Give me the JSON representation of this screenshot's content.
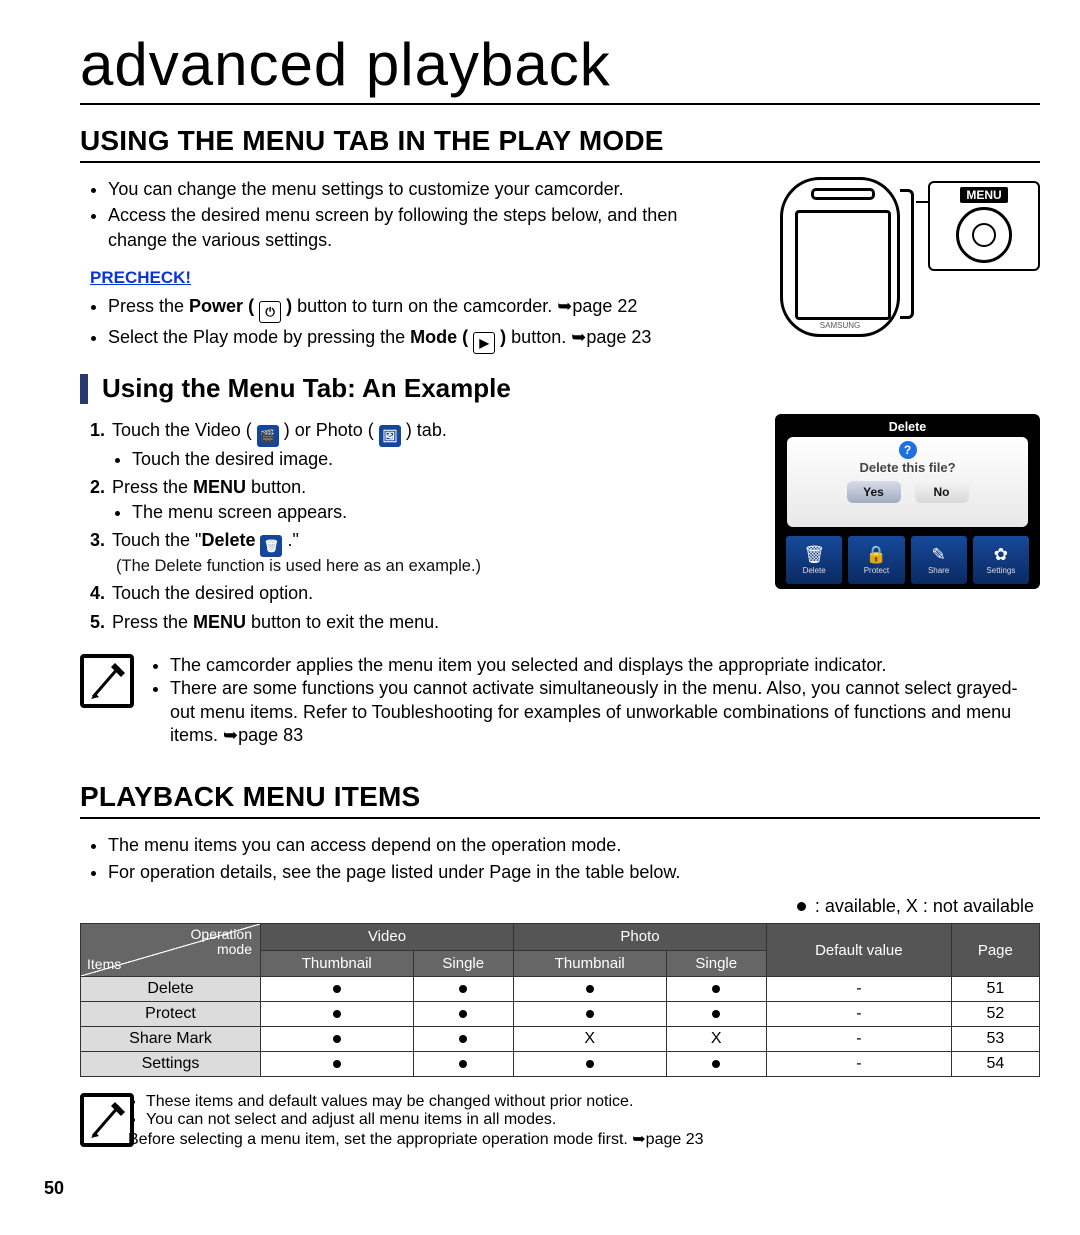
{
  "pageNumber": "50",
  "pageTitle": "advanced playback",
  "section1": {
    "heading": "USING THE MENU TAB IN THE PLAY MODE",
    "intro": [
      "You can change the menu settings to customize your camcorder.",
      "Access the desired menu screen by following the steps below, and then change the various settings."
    ],
    "precheckLabel": "PRECHECK!",
    "precheck": {
      "line1_a": "Press the ",
      "line1_b": "Power ( ",
      "line1_c": " )",
      "line1_d": " button to turn on the camcorder. ",
      "line1_page": "➥page 22",
      "line2_a": "Select the Play mode by pressing the ",
      "line2_b": "Mode ( ",
      "line2_c": " )",
      "line2_d": " button. ",
      "line2_page": "➥page 23"
    },
    "device": {
      "menuLabel": "MENU"
    }
  },
  "sub1": {
    "heading": "Using the Menu Tab: An Example",
    "step1_a": "Touch the Video ( ",
    "step1_b": " ) or Photo ( ",
    "step1_c": " ) tab.",
    "step1_sub": "Touch the desired image.",
    "step2_a": "Press the ",
    "step2_b": "MENU",
    "step2_c": " button.",
    "step2_sub": "The menu screen appears.",
    "step3_a": "Touch the \"",
    "step3_b": "Delete ",
    "step3_c": " .\"",
    "step3_note": "(The Delete function is used here as an example.)",
    "step4": "Touch the desired option.",
    "step5_a": "Press the ",
    "step5_b": "MENU",
    "step5_c": " button to exit the menu."
  },
  "screenshot": {
    "title": "Delete",
    "question": "Delete this file?",
    "yes": "Yes",
    "no": "No",
    "bar": [
      {
        "icon": "🗑",
        "label": "Delete"
      },
      {
        "icon": "🔒",
        "label": "Protect"
      },
      {
        "icon": "✎",
        "label": "Share"
      },
      {
        "icon": "✿",
        "label": "Settings"
      }
    ]
  },
  "note1": [
    "The camcorder applies the menu item you selected and displays the appropriate indicator.",
    "There are some functions you cannot activate simultaneously in the menu. Also, you cannot select grayed-out menu items. Refer to Toubleshooting for examples of unworkable combinations of functions and menu items. ➥page 83"
  ],
  "section2": {
    "heading": "PLAYBACK MENU ITEMS",
    "intro": [
      "The menu items you can access depend on the operation mode.",
      "For operation details, see the page listed under Page in the table below."
    ],
    "legend": " : available, X : not available"
  },
  "table": {
    "diagTop": "Operation\nmode",
    "diagBottom": "Items",
    "cols": {
      "video": "Video",
      "photo": "Photo",
      "thumbnail": "Thumbnail",
      "single": "Single",
      "defaultValue": "Default value",
      "page": "Page"
    },
    "rows": [
      {
        "name": "Delete",
        "vT": "●",
        "vS": "●",
        "pT": "●",
        "pS": "●",
        "def": "-",
        "page": "51"
      },
      {
        "name": "Protect",
        "vT": "●",
        "vS": "●",
        "pT": "●",
        "pS": "●",
        "def": "-",
        "page": "52"
      },
      {
        "name": "Share Mark",
        "vT": "●",
        "vS": "●",
        "pT": "X",
        "pS": "X",
        "def": "-",
        "page": "53"
      },
      {
        "name": "Settings",
        "vT": "●",
        "vS": "●",
        "pT": "●",
        "pS": "●",
        "def": "-",
        "page": "54"
      }
    ]
  },
  "note2": [
    "These items and default values may be changed without prior notice.",
    "You can not select and adjust all menu items in all modes.",
    "Before selecting a menu item, set the appropriate operation mode first. ➥page 23"
  ]
}
